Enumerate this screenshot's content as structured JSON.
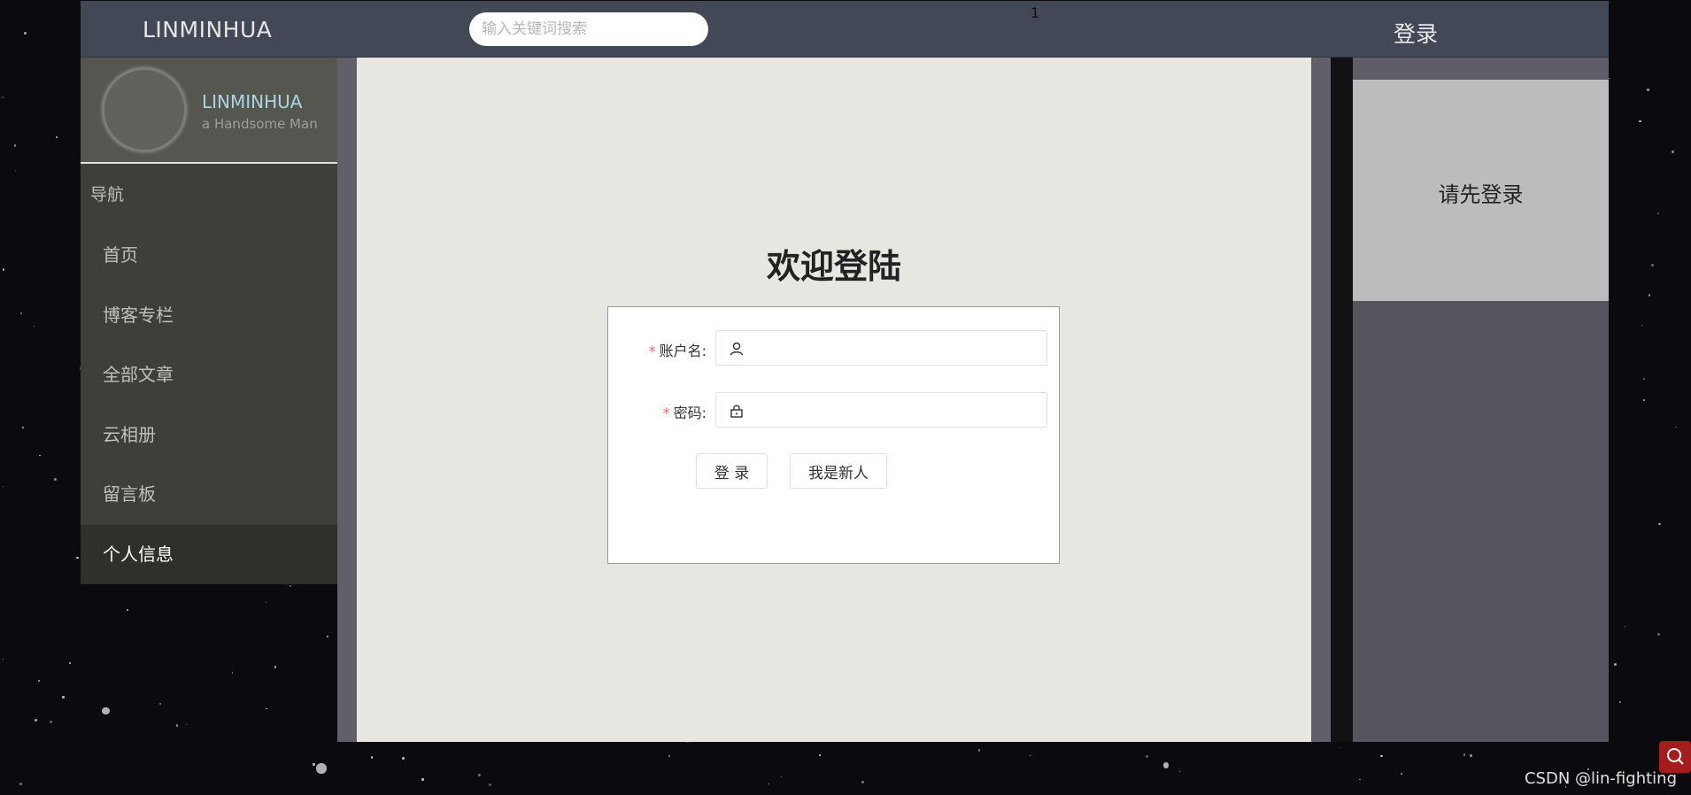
{
  "header": {
    "brand": "LINMINHUA",
    "search_placeholder": "输入关键词搜索",
    "counter": "1",
    "login_label": "登录"
  },
  "sidebar": {
    "profile_name": "LINMINHUA",
    "profile_subtitle": "a Handsome Man",
    "nav_heading": "导航",
    "items": [
      {
        "label": "首页"
      },
      {
        "label": "博客专栏"
      },
      {
        "label": "全部文章"
      },
      {
        "label": "云相册"
      },
      {
        "label": "留言板"
      },
      {
        "label": "个人信息",
        "active": true
      }
    ]
  },
  "main": {
    "welcome_title": "欢迎登陆",
    "form": {
      "required_mark": "*",
      "username_label": "账户名:",
      "password_label": "密码:",
      "username_value": "",
      "password_value": "",
      "login_button": "登 录",
      "register_button": "我是新人"
    }
  },
  "right_panel": {
    "prompt": "请先登录"
  },
  "watermark": "CSDN @lin-fighting",
  "colors": {
    "topbar": "#434857",
    "sidebar": "#3f3e38",
    "main_bg": "#e8e6e1",
    "required": "#f56c6c",
    "profile_name": "#a9d6e0"
  }
}
